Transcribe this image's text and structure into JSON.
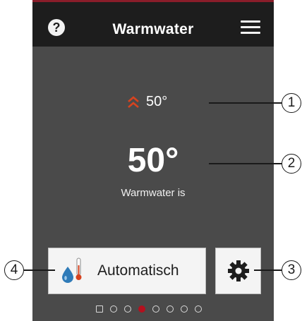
{
  "header": {
    "help_symbol": "?",
    "title": "Warmwater"
  },
  "main": {
    "setpoint_value": "50°",
    "current_value": "50°",
    "status_label": "Warmwater is"
  },
  "controls": {
    "auto_button_label": "Automatisch",
    "auto_icon": "water-temperature-icon",
    "settings_icon": "gear-icon"
  },
  "pagination": {
    "first_is_square": true,
    "total": 8,
    "active_index": 3
  },
  "callouts": [
    "1",
    "2",
    "3",
    "4"
  ],
  "colors": {
    "accent": "#d7431f",
    "active_dot": "#b4101e",
    "header_bg": "#1d1d1d",
    "screen_bg": "#4a4a4a",
    "drop_icon": "#2f7bb8"
  }
}
